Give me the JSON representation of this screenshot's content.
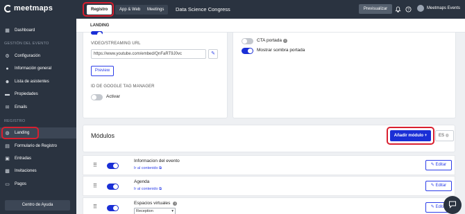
{
  "app": {
    "logo_text": "meetmaps",
    "event_name": "Data Science Congress"
  },
  "topnav": {
    "tabs": [
      {
        "label": "Registro"
      },
      {
        "label": "App & Web"
      },
      {
        "label": "Meetings"
      }
    ],
    "preview_label": "Previsualizar",
    "user_name": "Meetmaps Events",
    "bell_icon": "bell-icon",
    "help_icon": "help-icon"
  },
  "sidebar": {
    "sections": {
      "event": "GESTIÓN DEL EVENTO",
      "registro": "REGISTRO"
    },
    "items": [
      {
        "label": "Dashboard",
        "icon": "dashboard-icon"
      },
      {
        "label": "Configuración",
        "icon": "gear-icon"
      },
      {
        "label": "Información general",
        "icon": "info-icon"
      },
      {
        "label": "Lista de asistentes",
        "icon": "users-icon"
      },
      {
        "label": "Propiedades",
        "icon": "folder-icon"
      },
      {
        "label": "Emails",
        "icon": "mail-icon"
      },
      {
        "label": "Landing",
        "icon": "globe-icon"
      },
      {
        "label": "Formulario de Registro",
        "icon": "form-icon"
      },
      {
        "label": "Entradas",
        "icon": "ticket-icon"
      },
      {
        "label": "Invitaciones",
        "icon": "invite-icon"
      },
      {
        "label": "Pagos",
        "icon": "card-icon"
      }
    ],
    "help_label": "Centro de Ayuda"
  },
  "landing": {
    "breadcrumb": "LANDING",
    "video_label": "VIDEO/STREAMING URL",
    "video_url": "https://www.youtube.com/embed/QnFaRT9J0vc",
    "preview_button": "Preview",
    "gtm_label": "ID DE GOOGLE TAG MANAGER",
    "activar_label": "Activar",
    "cta_portada_label": "CTA portada",
    "sombra_portada_label": "Mostrar sombra portada"
  },
  "modules": {
    "title": "Módulos",
    "add_button": "Añadir módulo",
    "lang": "ES",
    "rows": [
      {
        "title": "Informacion del evento",
        "link": "Ir al contenido",
        "edit": "Editar"
      },
      {
        "title": "Agenda",
        "link": "Ir al contenido",
        "edit": "Editar"
      },
      {
        "title": "Espacios virtuales",
        "select_value": "Reception",
        "edit": "Editar"
      }
    ]
  },
  "colors": {
    "sidebar_bg": "#2a3340",
    "accent": "#1a2fd6",
    "highlight": "#d91f2f"
  }
}
